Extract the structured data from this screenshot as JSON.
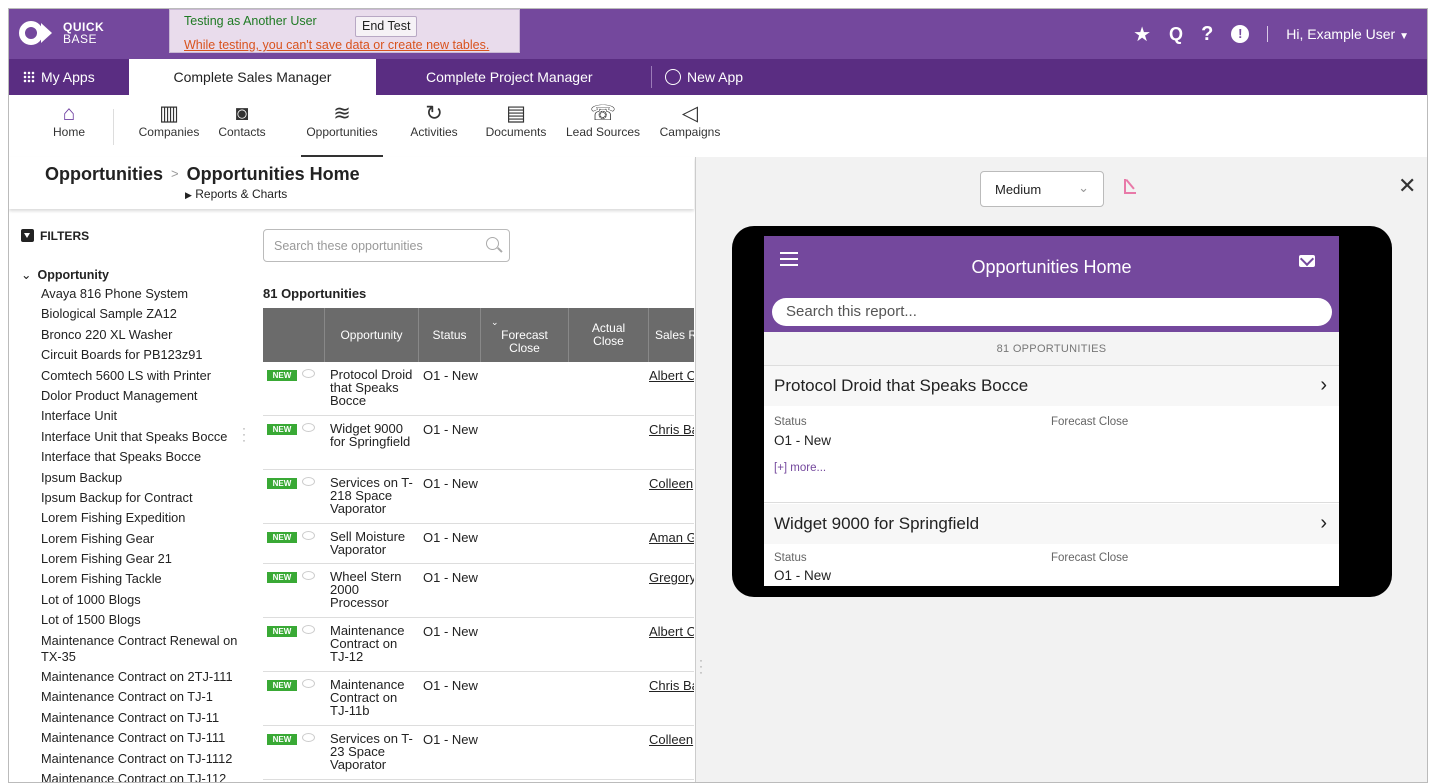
{
  "topbar": {
    "logo_line1": "QUICK",
    "logo_line2": "BASE",
    "test_title": "Testing as Another User",
    "end_test": "End Test",
    "test_warning": "While testing, you can't save data or create new tables.",
    "user": "Hi, Example User",
    "icons": [
      "star-icon",
      "search-icon",
      "help-icon",
      "alert-icon"
    ]
  },
  "appbar": {
    "my_apps": "My Apps",
    "tabs": [
      "Complete Sales Manager",
      "Complete Project Manager"
    ],
    "new_app": "New App"
  },
  "tables": [
    "Home",
    "Companies",
    "Contacts",
    "Opportunities",
    "Activities",
    "Documents",
    "Lead Sources",
    "Campaigns"
  ],
  "breadcrumb": {
    "table": "Opportunities",
    "page": "Opportunities Home",
    "reports": "Reports & Charts"
  },
  "filters": {
    "title": "FILTERS",
    "group": "Opportunity",
    "items": [
      "Avaya 816 Phone System",
      "Biological Sample ZA12",
      "Bronco 220 XL Washer",
      "Circuit Boards for PB123z91",
      "Comtech 5600 LS with Printer",
      "Dolor Product Management",
      "Interface Unit",
      "Interface Unit that Speaks Bocce",
      "Interface that Speaks Bocce",
      "Ipsum Backup",
      "Ipsum Backup for Contract",
      "Lorem Fishing Expedition",
      "Lorem Fishing Gear",
      "Lorem Fishing Gear 21",
      "Lorem Fishing Tackle",
      "Lot of 1000 Blogs",
      "Lot of 1500 Blogs",
      "Maintenance Contract Renewal on TX-35",
      "Maintenance Contract on 2TJ-111",
      "Maintenance Contract on TJ-1",
      "Maintenance Contract on TJ-11",
      "Maintenance Contract on TJ-111",
      "Maintenance Contract on TJ-1112",
      "Maintenance Contract on TJ-112"
    ]
  },
  "report": {
    "search_placeholder": "Search these opportunities",
    "count": "81 Opportunities",
    "columns": [
      "Opportunity",
      "Status",
      "Forecast Close",
      "Actual Close",
      "Sales R"
    ],
    "new_badge": "NEW",
    "rows": [
      {
        "opportunity": "Protocol Droid that Speaks Bocce",
        "status": "O1 - New",
        "rep": "Albert C"
      },
      {
        "opportunity": "Widget 9000 for Springfield",
        "status": "O1 - New",
        "rep": "Chris Ba"
      },
      {
        "opportunity": "Services on T-218 Space Vaporator",
        "status": "O1 - New",
        "rep": "Colleen"
      },
      {
        "opportunity": "Sell Moisture Vaporator",
        "status": "O1 - New",
        "rep": "Aman G"
      },
      {
        "opportunity": "Wheel Stern 2000 Processor",
        "status": "O1 - New",
        "rep": "Gregory"
      },
      {
        "opportunity": "Maintenance Contract on TJ-12",
        "status": "O1 - New",
        "rep": "Albert C"
      },
      {
        "opportunity": "Maintenance Contract on TJ-11b",
        "status": "O1 - New",
        "rep": "Chris Ba"
      },
      {
        "opportunity": "Services on T-23 Space Vaporator",
        "status": "O1 - New",
        "rep": "Colleen"
      }
    ]
  },
  "preview": {
    "size": "Medium",
    "mobile": {
      "title": "Opportunities Home",
      "search_placeholder": "Search this report...",
      "count": "81 OPPORTUNITIES",
      "status_label": "Status",
      "forecast_label": "Forecast Close",
      "more": "[+] more...",
      "cards": [
        {
          "title": "Protocol Droid that Speaks Bocce",
          "status": "O1 - New"
        },
        {
          "title": "Widget 9000 for Springfield",
          "status": "O1 - New"
        }
      ]
    }
  }
}
